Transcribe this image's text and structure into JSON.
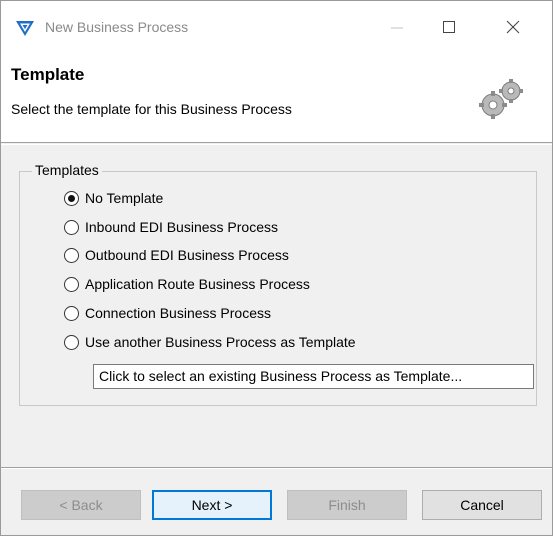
{
  "window": {
    "title": "New Business Process"
  },
  "header": {
    "title": "Template",
    "description": "Select the template for this Business Process"
  },
  "templates": {
    "legend": "Templates",
    "options": [
      {
        "label": "No Template",
        "checked": true
      },
      {
        "label": "Inbound EDI Business Process",
        "checked": false
      },
      {
        "label": "Outbound EDI Business Process",
        "checked": false
      },
      {
        "label": "Application Route Business Process",
        "checked": false
      },
      {
        "label": "Connection Business Process",
        "checked": false
      },
      {
        "label": "Use another Business Process as Template",
        "checked": false
      }
    ],
    "select_field_value": "Click to select an existing Business Process as Template..."
  },
  "buttons": {
    "back": "< Back",
    "next": "Next >",
    "finish": "Finish",
    "cancel": "Cancel"
  },
  "colors": {
    "accent": "#0078d7",
    "icon_blue": "#1e6fc5"
  }
}
